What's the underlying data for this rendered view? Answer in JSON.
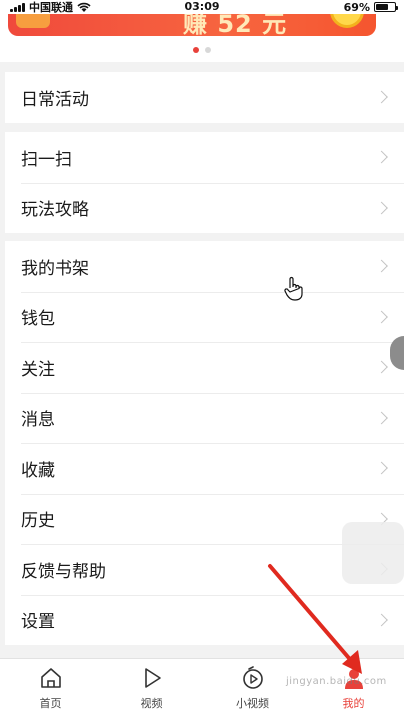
{
  "status_bar": {
    "carrier": "中国联通",
    "time": "03:09",
    "battery_pct": "69%",
    "battery_level": 0.69
  },
  "banner": {
    "text": "赚 52 元",
    "active_dot": 0
  },
  "groups": [
    {
      "items": [
        {
          "label": "日常活动"
        }
      ]
    },
    {
      "items": [
        {
          "label": "扫一扫"
        },
        {
          "label": "玩法攻略"
        }
      ]
    },
    {
      "items": [
        {
          "label": "我的书架"
        },
        {
          "label": "钱包"
        },
        {
          "label": "关注"
        },
        {
          "label": "消息"
        },
        {
          "label": "收藏"
        },
        {
          "label": "历史"
        },
        {
          "label": "反馈与帮助"
        },
        {
          "label": "设置"
        }
      ]
    }
  ],
  "tabs": [
    {
      "label": "首页",
      "icon": "home-icon"
    },
    {
      "label": "视频",
      "icon": "play-icon"
    },
    {
      "label": "小视频",
      "icon": "short-video-icon"
    },
    {
      "label": "我的",
      "icon": "profile-icon",
      "active": true
    }
  ],
  "accent_color": "#e8413a",
  "watermark": "jingyan.baidu.com"
}
